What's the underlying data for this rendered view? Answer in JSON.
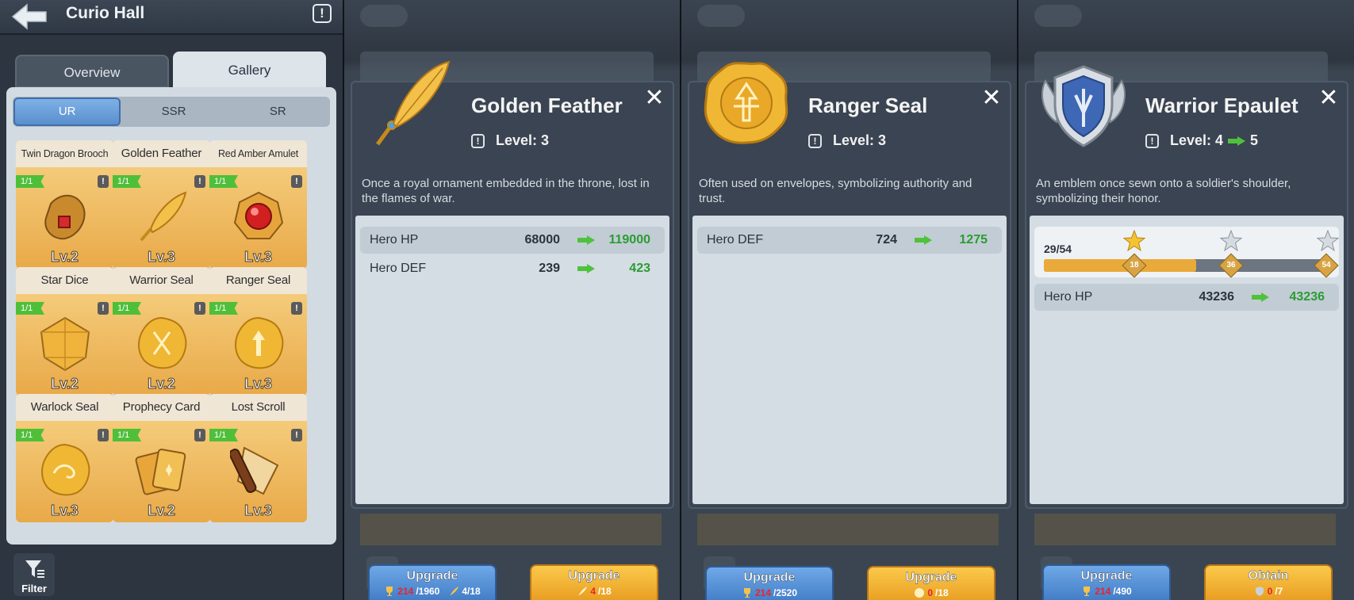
{
  "curio_hall": {
    "title": "Curio Hall",
    "tabs": [
      "Overview",
      "Gallery"
    ],
    "subtabs": [
      "UR",
      "SSR",
      "SR"
    ],
    "cards": [
      {
        "name": "Twin Dragon Brooch",
        "badge": "1/1",
        "level": "Lv.2",
        "icon": "dragon-brooch-icon"
      },
      {
        "name": "Golden Feather",
        "badge": "1/1",
        "level": "Lv.3",
        "icon": "golden-feather-icon"
      },
      {
        "name": "Red Amber Amulet",
        "badge": "1/1",
        "level": "Lv.3",
        "icon": "amber-amulet-icon"
      },
      {
        "name": "Star Dice",
        "badge": "1/1",
        "level": "Lv.2",
        "icon": "star-dice-icon"
      },
      {
        "name": "Warrior Seal",
        "badge": "1/1",
        "level": "Lv.2",
        "icon": "warrior-seal-icon"
      },
      {
        "name": "Ranger Seal",
        "badge": "1/1",
        "level": "Lv.3",
        "icon": "ranger-seal-icon"
      },
      {
        "name": "Warlock Seal",
        "badge": "1/1",
        "level": "Lv.3",
        "icon": "warlock-seal-icon"
      },
      {
        "name": "Prophecy Card",
        "badge": "1/1",
        "level": "Lv.2",
        "icon": "prophecy-card-icon"
      },
      {
        "name": "Lost Scroll",
        "badge": "1/1",
        "level": "Lv.3",
        "icon": "lost-scroll-icon"
      }
    ],
    "filter_label": "Filter"
  },
  "popup_feather": {
    "title": "Golden Feather",
    "level": "Level: 3",
    "description": "Once a royal ornament embedded in the throne, lost in the flames of war.",
    "stats": [
      {
        "label": "Hero HP",
        "from": "68000",
        "to": "119000"
      },
      {
        "label": "Hero DEF",
        "from": "239",
        "to": "423"
      }
    ],
    "btn_left": {
      "title": "Upgrade",
      "have": "214",
      "need": "/1960",
      "extra": "4/18"
    },
    "btn_right": {
      "title": "Upgrade",
      "have": "4",
      "need": "/18"
    }
  },
  "popup_ranger": {
    "title": "Ranger Seal",
    "level": "Level: 3",
    "description": "Often used on envelopes, symbolizing authority and trust.",
    "stats": [
      {
        "label": "Hero DEF",
        "from": "724",
        "to": "1275"
      }
    ],
    "btn_left": {
      "title": "Upgrade",
      "have": "214",
      "need": "/2520"
    },
    "btn_right": {
      "title": "Upgrade",
      "have": "0",
      "need": "/18"
    }
  },
  "popup_epaulet": {
    "title": "Warrior Epaulet",
    "level_from": "Level: 4",
    "level_to": "5",
    "description": "An emblem once sewn onto a soldier's shoulder, symbolizing their honor.",
    "progress_text": "29/54",
    "progress_value": 29,
    "progress_max": 54,
    "milestones": [
      "18",
      "36",
      "54"
    ],
    "stats": [
      {
        "label": "Hero HP",
        "from": "43236",
        "to": "43236"
      }
    ],
    "btn_left": {
      "title": "Upgrade",
      "have": "214",
      "need": "/490"
    },
    "btn_right": {
      "title": "Obtain",
      "have": "0",
      "need": "/7"
    }
  },
  "colors": {
    "accent_gold": "#e9aa3a",
    "accent_blue": "#4a86d0",
    "stat_green": "#2a9c32",
    "cost_red": "#e8242c"
  }
}
